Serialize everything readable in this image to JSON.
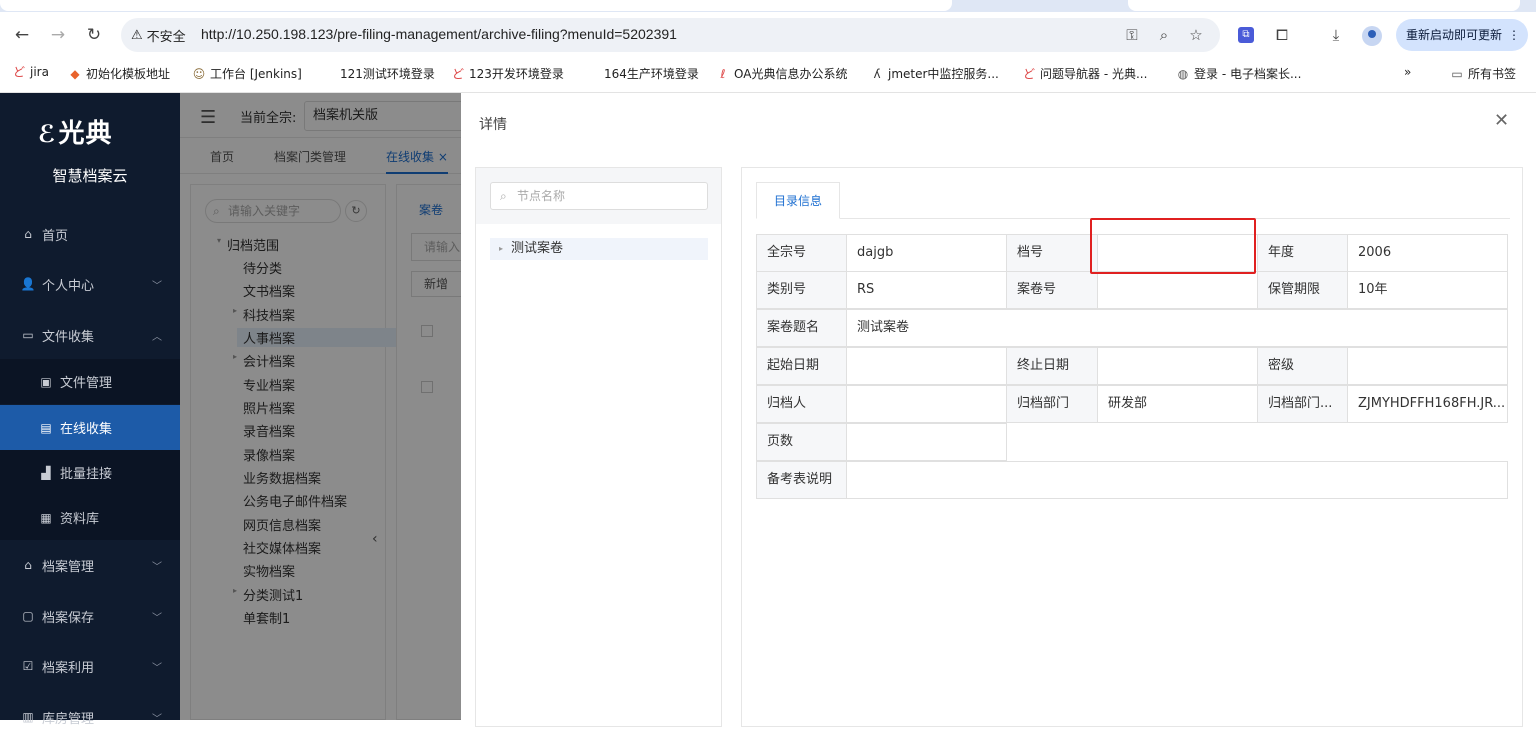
{
  "browser": {
    "security_label": "不安全",
    "url": "http://10.250.198.123/pre-filing-management/archive-filing?menuId=5202391",
    "update_button": "重新启动即可更新",
    "bookmarks": [
      {
        "label": "jira",
        "icon": "jira-icon"
      },
      {
        "label": "初始化模板地址",
        "icon": "gitlab-icon"
      },
      {
        "label": "工作台 [Jenkins]",
        "icon": "jenkins-icon"
      },
      {
        "label": "121测试环境登录",
        "icon": ""
      },
      {
        "label": "123开发环境登录",
        "icon": "jira-icon"
      },
      {
        "label": "164生产环境登录",
        "icon": ""
      },
      {
        "label": "OA光典信息办公系统",
        "icon": "oa-icon"
      },
      {
        "label": "jmeter中监控服务...",
        "icon": "jmeter-icon"
      },
      {
        "label": "问题导航器 - 光典...",
        "icon": "jira-icon"
      },
      {
        "label": "登录 - 电子档案长...",
        "icon": "globe-icon"
      }
    ],
    "all_bookmarks": "所有书签"
  },
  "sidebar": {
    "logo": "光典",
    "subtitle": "智慧档案云",
    "items": [
      {
        "label": "首页",
        "icon": "home-icon"
      },
      {
        "label": "个人中心",
        "icon": "user-icon"
      },
      {
        "label": "文件收集",
        "icon": "folder-icon"
      },
      {
        "label": "文件管理",
        "icon": "file-manage-icon"
      },
      {
        "label": "在线收集",
        "icon": "doc-icon"
      },
      {
        "label": "批量挂接",
        "icon": "bar-chart-icon"
      },
      {
        "label": "资料库",
        "icon": "calendar-icon"
      },
      {
        "label": "档案管理",
        "icon": "bank-icon"
      },
      {
        "label": "档案保存",
        "icon": "save-icon"
      },
      {
        "label": "档案利用",
        "icon": "check-icon"
      },
      {
        "label": "库房管理",
        "icon": "warehouse-icon"
      }
    ]
  },
  "page": {
    "current_fonds_label": "当前全宗:",
    "current_fonds_value": "档案机关版",
    "tabs": [
      "首页",
      "档案门类管理",
      "在线收集"
    ],
    "tree_search_placeholder": "请输入关键字",
    "tree": [
      "归档范围",
      "待分类",
      "文书档案",
      "科技档案",
      "人事档案",
      "会计档案",
      "专业档案",
      "照片档案",
      "录音档案",
      "录像档案",
      "业务数据档案",
      "公务电子邮件档案",
      "网页信息档案",
      "社交媒体档案",
      "实物档案",
      "分类测试1",
      "单套制1"
    ],
    "right_tab": "案卷",
    "right_input": "请输入",
    "right_button": "新增"
  },
  "drawer": {
    "title": "详情",
    "node_search_placeholder": "节点名称",
    "tree_node": "测试案卷",
    "tab": "目录信息",
    "fields": {
      "qzh_label": "全宗号",
      "qzh_value": "dajgb",
      "dh_label": "档号",
      "dh_value": "",
      "nd_label": "年度",
      "nd_value": "2006",
      "lbh_label": "类别号",
      "lbh_value": "RS",
      "ajh_label": "案卷号",
      "ajh_value": "",
      "bgqx_label": "保管期限",
      "bgqx_value": "10年",
      "ajtm_label": "案卷题名",
      "ajtm_value": "测试案卷",
      "qsrq_label": "起始日期",
      "qsrq_value": "",
      "zzrq_label": "终止日期",
      "zzrq_value": "",
      "mj_label": "密级",
      "mj_value": "",
      "gdr_label": "归档人",
      "gdr_value": "",
      "gdbm_label": "归档部门",
      "gdbm_value": "研发部",
      "gdbm2_label": "归档部门...",
      "gdbm2_value": "ZJMYHDFFH168FH.JR...",
      "ys_label": "页数",
      "ys_value": "",
      "bkb_label": "备考表说明",
      "bkb_value": ""
    }
  },
  "colors": {
    "accent": "#1d6fd1",
    "sidebar": "#0f1b2e",
    "highlight": "#e02020"
  }
}
